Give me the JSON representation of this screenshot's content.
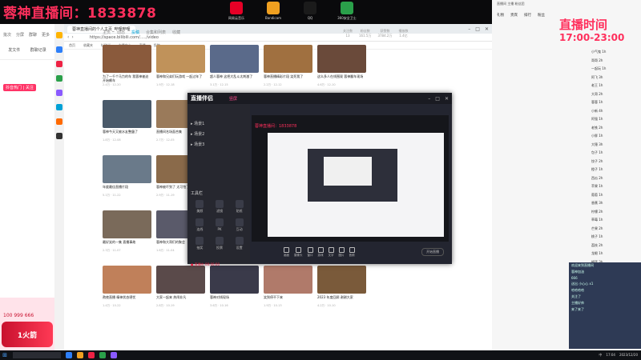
{
  "banner": {
    "stream_title": "蓉神直播间：1833878"
  },
  "desktop_icons": [
    {
      "label": "网易云音乐",
      "color": "#e60026"
    },
    {
      "label": "Bandicam",
      "color": "#f0a020"
    },
    {
      "label": "QQ",
      "color": "#1b1b1b"
    },
    {
      "label": "360安全卫士",
      "color": "#2aa04a"
    }
  ],
  "left_panel": {
    "toolbar": [
      "批次",
      "分屏",
      "群聊",
      "更多"
    ],
    "actions": [
      "发文件",
      "群聊记录"
    ],
    "ad_label": "抖音热门 | 关注",
    "gift_counts": "100   999   666",
    "gift_badge": "1火箭"
  },
  "browser": {
    "tab_title": "蓉神直播间的个人主页_哔哩哔哩",
    "url": "https://space.bilibili.com/...../video",
    "bookmarks": [
      "首页",
      "收藏夹",
      "bilibili",
      "主播中心",
      "直播",
      "投稿"
    ],
    "page_tabs": [
      "主页",
      "动态",
      "投稿",
      "合集和列表",
      "收藏"
    ],
    "active_tab": "投稿",
    "stats": [
      {
        "label": "关注数",
        "value": "13"
      },
      {
        "label": "粉丝数",
        "value": "161.5万"
      },
      {
        "label": "获赞数",
        "value": "3784.2万"
      },
      {
        "label": "播放数",
        "value": "1.4亿"
      }
    ],
    "videos": [
      [
        {
          "title": "为了一千个马力的车 我蓉神被迫开始飙车",
          "meta": "2.4万 · 12-20",
          "color": "#8a5a3c"
        },
        {
          "title": "蓉神和兄弟们玩游戏 一起过年了",
          "meta": "1.9万 · 12-18",
          "color": "#c0925a"
        },
        {
          "title": "超人蓉神 这把大乱斗太刺激了",
          "meta": "3.1万 · 12-15",
          "color": "#5a6a8a"
        },
        {
          "title": "蓉神直播精彩片段 笑死我了",
          "meta": "2.2万 · 12-12",
          "color": "#a07040"
        },
        {
          "title": "这么多人在线围观 蓉神翻车现场",
          "meta": "4.6万 · 12-10",
          "color": "#6a4a3a"
        }
      ],
      [
        {
          "title": "蓉神今天又被水友整蛊了",
          "meta": "1.8万 · 12-08",
          "color": "#4a5a6a"
        },
        {
          "title": "直播间名场面合集",
          "meta": "2.7万 · 12-05",
          "color": "#9a7a5a"
        },
        {
          "title": "这是我见过最离谱的操作",
          "meta": "3.3万 · 12-02",
          "color": "#3a4a5a"
        },
        {
          "title": "蓉神的一天 vlog",
          "meta": "1.5万 · 11-29",
          "color": "#b08060"
        },
        {
          "title": "与水友的对决 谁赢了",
          "meta": "2.0万 · 11-26",
          "color": "#7a5a4a"
        }
      ],
      [
        {
          "title": "年度最佳直播片段",
          "meta": "5.1万 · 11-22",
          "color": "#6a7a8a"
        },
        {
          "title": "蓉神被吓到了 太可怕了",
          "meta": "2.9万 · 11-19",
          "color": "#8a6a4a"
        },
        {
          "title": "今天吃什么 蓉神探店",
          "meta": "1.7万 · 11-16",
          "color": "#5a4a3a"
        },
        {
          "title": "深夜直播 聊聊天",
          "meta": "1.2万 · 11-13",
          "color": "#4a3a4a"
        },
        {
          "title": "蓉神又双叒叕翻车了",
          "meta": "3.8万 · 11-10",
          "color": "#9a6a5a"
        }
      ],
      [
        {
          "title": "最好笑的一集 直播事故",
          "meta": "2.3万 · 11-07",
          "color": "#7a6a5a"
        },
        {
          "title": "蓉神和大哥们的聚会",
          "meta": "1.6万 · 11-04",
          "color": "#5a5a6a"
        },
        {
          "title": "这次真的不一样",
          "meta": "2.5万 · 11-01",
          "color": "#8a5a4a"
        },
        {
          "title": "终于等到这一天",
          "meta": "3.0万 · 10-28",
          "color": "#6a4a5a"
        },
        {
          "title": "看完这个你就懂了",
          "meta": "2.1万 · 10-25",
          "color": "#a07a5a"
        }
      ],
      [
        {
          "title": "熬夜直播 精神状态堪忧",
          "meta": "1.4万 · 10-22",
          "color": "#c0805a"
        },
        {
          "title": "大家一起来 热闹非凡",
          "meta": "2.8万 · 10-19",
          "color": "#5a4a4a"
        },
        {
          "title": "蓉神对线现场",
          "meta": "3.6万 · 10-16",
          "color": "#3a3a4a"
        },
        {
          "title": "笑到停不下来",
          "meta": "1.9万 · 10-13",
          "color": "#b07a6a"
        },
        {
          "title": "2023 年度回顾 谢谢大家",
          "meta": "4.2万 · 10-10",
          "color": "#7a5a3a"
        }
      ]
    ]
  },
  "live_app": {
    "logo": "直播伴侣",
    "mode": "竖屏",
    "scenes": [
      "场景1",
      "场景2",
      "场景3"
    ],
    "tools_title": "工具栏",
    "tools": [
      "美颜",
      "滤镜",
      "贴纸",
      "连线",
      "PK",
      "互动",
      "抽奖",
      "投票",
      "设置"
    ],
    "preview_label": "蓉神直播间：1833878",
    "toolbar": [
      "画面",
      "摄像头",
      "窗口",
      "游戏",
      "文字",
      "图片",
      "音频"
    ],
    "settings_button": "开始直播",
    "status": "● 直播中  00:00:00"
  },
  "right_panel": {
    "header": "直播间  主播  粉丝团",
    "nav": [
      "礼物",
      "贵宾",
      "排行",
      "粉丝"
    ],
    "time_label": "直播时间",
    "time_range": "17:00-23:00",
    "list": [
      "小气鬼 1h",
      "哥哥 2h",
      "一起玩 1h",
      "阿飞 3h",
      "老王 1h",
      "大哥 2h",
      "蓉蓉 1h",
      "小新 4h",
      "阿强 1h",
      "老铁 2h",
      "小胖 1h",
      "大锤 3h",
      "包子 1h",
      "饺子 2h",
      "橙子 1h",
      "西瓜 2h",
      "苹果 1h",
      "葡萄 1h",
      "香蕉 3h",
      "柠檬 2h",
      "草莓 1h",
      "芒果 2h",
      "桃子 1h",
      "荔枝 2h",
      "龙眼 1h",
      "榴莲 3h",
      "菠萝 1h"
    ],
    "chat": [
      "欢迎来到直播间",
      "蓉神加油",
      "666",
      "送出 小心心 x1",
      "哈哈哈哈",
      "关注了",
      "主播好帅",
      "来了来了"
    ]
  },
  "taskbar": {
    "apps": [
      "#2d7ff9",
      "#f0a020",
      "#e24",
      "#2aa04a",
      "#8a5aff"
    ],
    "tray": [
      "中",
      "17:04",
      "2023/12/20"
    ]
  }
}
